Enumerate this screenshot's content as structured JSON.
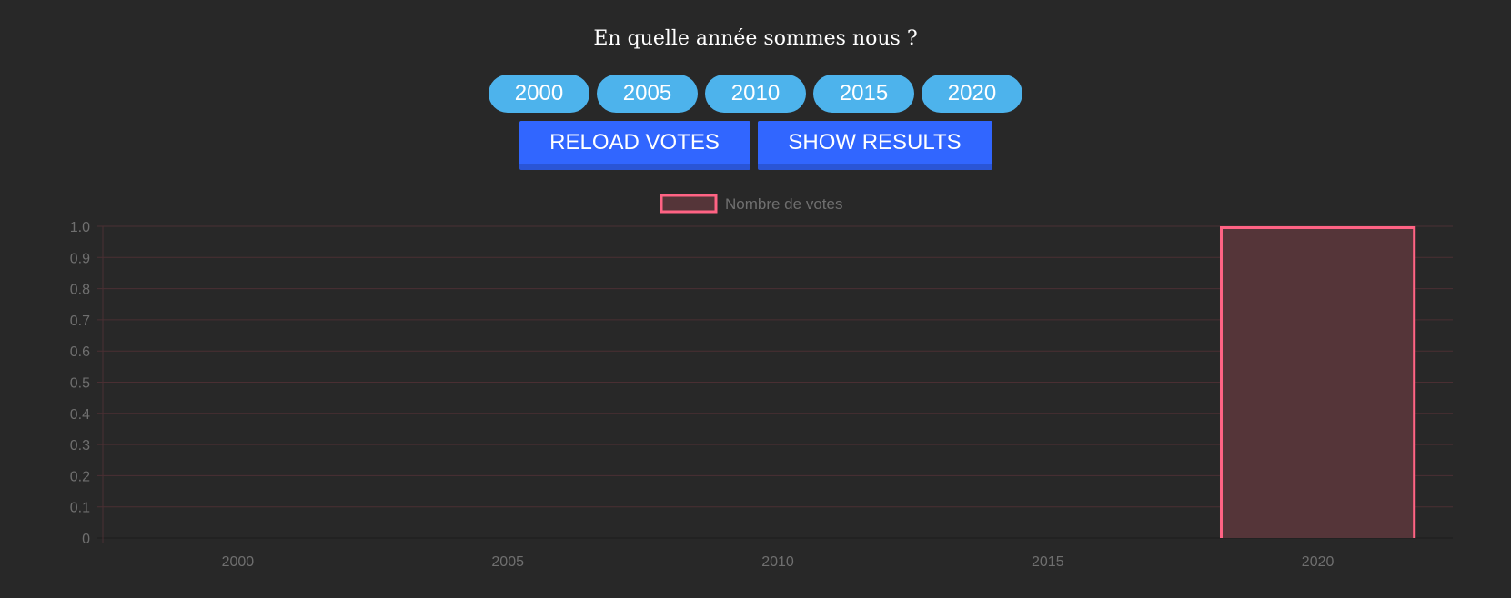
{
  "question": "En quelle année sommes nous ?",
  "vote_buttons": [
    "2000",
    "2005",
    "2010",
    "2015",
    "2020"
  ],
  "actions": {
    "reload_label": "RELOAD VOTES",
    "show_label": "SHOW RESULTS"
  },
  "colors": {
    "background": "#282828",
    "vote_button": "#4db3ec",
    "action_button": "#3166ff",
    "bar_border": "#ff6384",
    "bar_fill": "#553539",
    "grid": "#4a2f33",
    "tick_text": "#6f6f6f"
  },
  "chart_data": {
    "type": "bar",
    "categories": [
      "2000",
      "2005",
      "2010",
      "2015",
      "2020"
    ],
    "series": [
      {
        "name": "Nombre de votes",
        "values": [
          0,
          0,
          0,
          0,
          1
        ]
      }
    ],
    "ylim": [
      0,
      1
    ],
    "y_ticks": [
      "0",
      "0.1",
      "0.2",
      "0.3",
      "0.4",
      "0.5",
      "0.6",
      "0.7",
      "0.8",
      "0.9",
      "1.0"
    ],
    "grid": true,
    "legend": "top-center"
  }
}
